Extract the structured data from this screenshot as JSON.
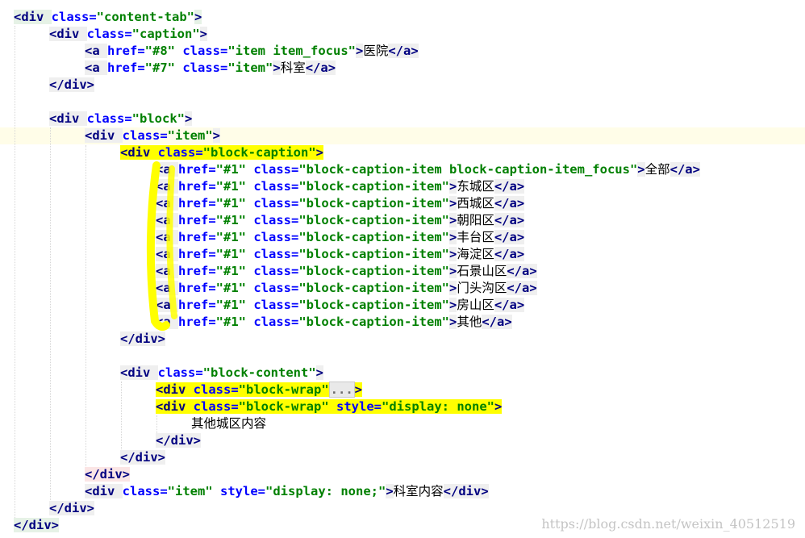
{
  "editor": {
    "lines": [
      {
        "indent": 0,
        "parts": [
          [
            "tag",
            "<div "
          ],
          [
            "attr",
            "class="
          ],
          [
            "val",
            "\"content-tab\""
          ],
          [
            "tag",
            ">"
          ]
        ]
      },
      {
        "indent": 1,
        "parts": [
          [
            "tag",
            "<div "
          ],
          [
            "attr",
            "class="
          ],
          [
            "val",
            "\"caption\""
          ],
          [
            "tag",
            ">"
          ]
        ]
      },
      {
        "indent": 2,
        "parts": [
          [
            "tag",
            "<a "
          ],
          [
            "attr",
            "href="
          ],
          [
            "val",
            "\"#8\" "
          ],
          [
            "attr",
            "class="
          ],
          [
            "val",
            "\"item item_focus\""
          ],
          [
            "tag",
            ">"
          ],
          [
            "txt",
            "医院"
          ],
          [
            "tag",
            "</a>"
          ]
        ]
      },
      {
        "indent": 2,
        "parts": [
          [
            "tag",
            "<a "
          ],
          [
            "attr",
            "href="
          ],
          [
            "val",
            "\"#7\" "
          ],
          [
            "attr",
            "class="
          ],
          [
            "val",
            "\"item\""
          ],
          [
            "tag",
            ">"
          ],
          [
            "txt",
            "科室"
          ],
          [
            "tag",
            "</a>"
          ]
        ]
      },
      {
        "indent": 1,
        "parts": [
          [
            "tag",
            "</div>"
          ]
        ]
      },
      {
        "indent": 0,
        "parts": []
      },
      {
        "indent": 1,
        "parts": [
          [
            "tag",
            "<div "
          ],
          [
            "attr",
            "class="
          ],
          [
            "val",
            "\"block\""
          ],
          [
            "tag",
            ">"
          ]
        ]
      },
      {
        "indent": 2,
        "parts": [
          [
            "tag",
            "<div "
          ],
          [
            "attr",
            "class="
          ],
          [
            "val",
            "\"item\""
          ],
          [
            "tag",
            ">"
          ]
        ]
      },
      {
        "indent": 3,
        "parts": [
          [
            "tag",
            "<div "
          ],
          [
            "attr",
            "class="
          ],
          [
            "val",
            "\"block-caption\""
          ],
          [
            "tag",
            ">"
          ]
        ]
      },
      {
        "indent": 4,
        "parts": [
          [
            "tag",
            "<a "
          ],
          [
            "attr",
            "href="
          ],
          [
            "val",
            "\"#1\" "
          ],
          [
            "attr",
            "class="
          ],
          [
            "val",
            "\"block-caption-item block-caption-item_focus\""
          ],
          [
            "tag",
            ">"
          ],
          [
            "txt",
            "全部"
          ],
          [
            "tag",
            "</a>"
          ]
        ]
      },
      {
        "indent": 4,
        "parts": [
          [
            "tag",
            "<a "
          ],
          [
            "attr",
            "href="
          ],
          [
            "val",
            "\"#1\" "
          ],
          [
            "attr",
            "class="
          ],
          [
            "val",
            "\"block-caption-item\""
          ],
          [
            "tag",
            ">"
          ],
          [
            "txt",
            "东城区"
          ],
          [
            "tag",
            "</a>"
          ]
        ]
      },
      {
        "indent": 4,
        "parts": [
          [
            "tag",
            "<a "
          ],
          [
            "attr",
            "href="
          ],
          [
            "val",
            "\"#1\" "
          ],
          [
            "attr",
            "class="
          ],
          [
            "val",
            "\"block-caption-item\""
          ],
          [
            "tag",
            ">"
          ],
          [
            "txt",
            "西城区"
          ],
          [
            "tag",
            "</a>"
          ]
        ]
      },
      {
        "indent": 4,
        "parts": [
          [
            "tag",
            "<a "
          ],
          [
            "attr",
            "href="
          ],
          [
            "val",
            "\"#1\" "
          ],
          [
            "attr",
            "class="
          ],
          [
            "val",
            "\"block-caption-item\""
          ],
          [
            "tag",
            ">"
          ],
          [
            "txt",
            "朝阳区"
          ],
          [
            "tag",
            "</a>"
          ]
        ]
      },
      {
        "indent": 4,
        "parts": [
          [
            "tag",
            "<a "
          ],
          [
            "attr",
            "href="
          ],
          [
            "val",
            "\"#1\" "
          ],
          [
            "attr",
            "class="
          ],
          [
            "val",
            "\"block-caption-item\""
          ],
          [
            "tag",
            ">"
          ],
          [
            "txt",
            "丰台区"
          ],
          [
            "tag",
            "</a>"
          ]
        ]
      },
      {
        "indent": 4,
        "parts": [
          [
            "tag",
            "<a "
          ],
          [
            "attr",
            "href="
          ],
          [
            "val",
            "\"#1\" "
          ],
          [
            "attr",
            "class="
          ],
          [
            "val",
            "\"block-caption-item\""
          ],
          [
            "tag",
            ">"
          ],
          [
            "txt",
            "海淀区"
          ],
          [
            "tag",
            "</a>"
          ]
        ]
      },
      {
        "indent": 4,
        "parts": [
          [
            "tag",
            "<a "
          ],
          [
            "attr",
            "href="
          ],
          [
            "val",
            "\"#1\" "
          ],
          [
            "attr",
            "class="
          ],
          [
            "val",
            "\"block-caption-item\""
          ],
          [
            "tag",
            ">"
          ],
          [
            "txt",
            "石景山区"
          ],
          [
            "tag",
            "</a>"
          ]
        ]
      },
      {
        "indent": 4,
        "parts": [
          [
            "tag",
            "<a "
          ],
          [
            "attr",
            "href="
          ],
          [
            "val",
            "\"#1\" "
          ],
          [
            "attr",
            "class="
          ],
          [
            "val",
            "\"block-caption-item\""
          ],
          [
            "tag",
            ">"
          ],
          [
            "txt",
            "门头沟区"
          ],
          [
            "tag",
            "</a>"
          ]
        ]
      },
      {
        "indent": 4,
        "parts": [
          [
            "tag",
            "<a "
          ],
          [
            "attr",
            "href="
          ],
          [
            "val",
            "\"#1\" "
          ],
          [
            "attr",
            "class="
          ],
          [
            "val",
            "\"block-caption-item\""
          ],
          [
            "tag",
            ">"
          ],
          [
            "txt",
            "房山区"
          ],
          [
            "tag",
            "</a>"
          ]
        ]
      },
      {
        "indent": 4,
        "parts": [
          [
            "tag",
            "<a "
          ],
          [
            "attr",
            "href="
          ],
          [
            "val",
            "\"#1\" "
          ],
          [
            "attr",
            "class="
          ],
          [
            "val",
            "\"block-caption-item\""
          ],
          [
            "tag",
            ">"
          ],
          [
            "txt",
            "其他"
          ],
          [
            "tag",
            "</a>"
          ]
        ]
      },
      {
        "indent": 3,
        "parts": [
          [
            "tag",
            "</div>"
          ]
        ]
      },
      {
        "indent": 0,
        "parts": []
      },
      {
        "indent": 3,
        "parts": [
          [
            "tag",
            "<div "
          ],
          [
            "attr",
            "class="
          ],
          [
            "val",
            "\"block-content\""
          ],
          [
            "tag",
            ">"
          ]
        ]
      },
      {
        "indent": 4,
        "parts": [
          [
            "tag",
            "<div "
          ],
          [
            "attr",
            "class="
          ],
          [
            "val",
            "\"block-wrap\""
          ],
          [
            "fold",
            "..."
          ],
          [
            "tag",
            ">"
          ]
        ]
      },
      {
        "indent": 4,
        "parts": [
          [
            "tag",
            "<div "
          ],
          [
            "attr",
            "class="
          ],
          [
            "val",
            "\"block-wrap\" "
          ],
          [
            "attr",
            "style="
          ],
          [
            "val",
            "\"display: none\""
          ],
          [
            "tag",
            ">"
          ]
        ]
      },
      {
        "indent": 5,
        "parts": [
          [
            "txt",
            "其他城区内容"
          ]
        ]
      },
      {
        "indent": 4,
        "parts": [
          [
            "tag",
            "</div>"
          ]
        ]
      },
      {
        "indent": 3,
        "parts": [
          [
            "tag",
            "</div>"
          ]
        ]
      },
      {
        "indent": 2,
        "parts": [
          [
            "tag",
            "</div>"
          ]
        ]
      },
      {
        "indent": 2,
        "parts": [
          [
            "tag",
            "<div "
          ],
          [
            "attr",
            "class="
          ],
          [
            "val",
            "\"item\" "
          ],
          [
            "attr",
            "style="
          ],
          [
            "val",
            "\"display: none;\""
          ],
          [
            "tag",
            ">"
          ],
          [
            "txt",
            "科室内容"
          ],
          [
            "tag",
            "</div>"
          ]
        ]
      },
      {
        "indent": 1,
        "parts": [
          [
            "tag",
            "</div>"
          ]
        ]
      },
      {
        "indent": 0,
        "parts": [
          [
            "tag",
            "</div>"
          ]
        ]
      }
    ]
  },
  "watermark": "https://blog.csdn.net/weixin_40512519",
  "colors": {
    "tag": "#000080",
    "attribute": "#0000ff",
    "value": "#008000",
    "highlight": "#ffff00",
    "current_line": "#fffde8"
  }
}
